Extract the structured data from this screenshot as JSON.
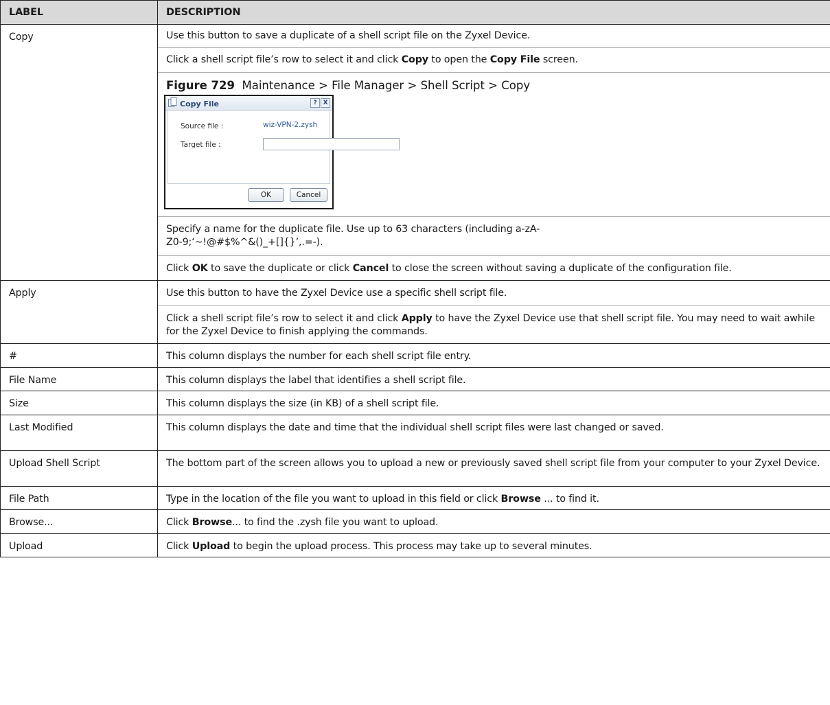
{
  "table": {
    "header": {
      "label": "LABEL",
      "description": "DESCRIPTION"
    },
    "copy": {
      "label": "Copy",
      "p1": "Use this button to save a duplicate of a shell script file on the Zyxel Device.",
      "p2_a": "Click a shell script file’s row to select it and click ",
      "p2_b": "Copy",
      "p2_c": " to open the ",
      "p2_d": "Copy File",
      "p2_e": " screen.",
      "figure_number": "Figure 729",
      "figure_caption": "Maintenance > File Manager > Shell Script > Copy",
      "p3": "Specify a name for the duplicate file. Use up to 63 characters (including a-zA-Z0-9;‘~!@#$%^&()_+[]{}’,.=-).",
      "p4_a": "Click ",
      "p4_b": "OK",
      "p4_c": " to save the duplicate or click ",
      "p4_d": "Cancel",
      "p4_e": " to close the screen without saving a duplicate of the configuration file."
    },
    "apply": {
      "label": "Apply",
      "p1": "Use this button to have the Zyxel Device use a specific shell script file.",
      "p2_a": "Click a shell script file’s row to select it and click ",
      "p2_b": "Apply",
      "p2_c": " to have the Zyxel Device use that shell script file. You may need to wait awhile for the Zyxel Device to finish applying the commands."
    },
    "hash": {
      "label": "#",
      "desc": "This column displays the number for each shell script file entry."
    },
    "file_name": {
      "label": "File Name",
      "desc": "This column displays the label that identifies a shell script file."
    },
    "size": {
      "label": "Size",
      "desc": "This column displays the size (in KB) of a shell script file."
    },
    "last_modified": {
      "label": "Last Modified",
      "desc": "This column displays the date and time that the individual shell script files were last changed or saved."
    },
    "upload_shell_script": {
      "label": "Upload Shell Script",
      "desc": "The bottom part of the screen allows you to upload a new or previously saved shell script file from your computer to your Zyxel Device."
    },
    "file_path": {
      "label": "File Path",
      "desc_a": "Type in the location of the file you want to upload in this field or click ",
      "desc_b": "Browse",
      "desc_c": " ... to find it."
    },
    "browse": {
      "label": "Browse...",
      "desc_a": "Click ",
      "desc_b": "Browse",
      "desc_c": "... to find the .zysh file you want to upload."
    },
    "upload": {
      "label": "Upload",
      "desc_a": "Click ",
      "desc_b": "Upload",
      "desc_c": " to begin the upload process. This process may take up to several minutes."
    }
  },
  "dialog": {
    "title": "Copy File",
    "help_btn": "?",
    "close_btn": "X",
    "source_label": "Source file :",
    "source_value": "wiz-VPN-2.zysh",
    "target_label": "Target file :",
    "target_value": "",
    "ok": "OK",
    "cancel": "Cancel",
    "title_icon": "copy-file-icon"
  }
}
